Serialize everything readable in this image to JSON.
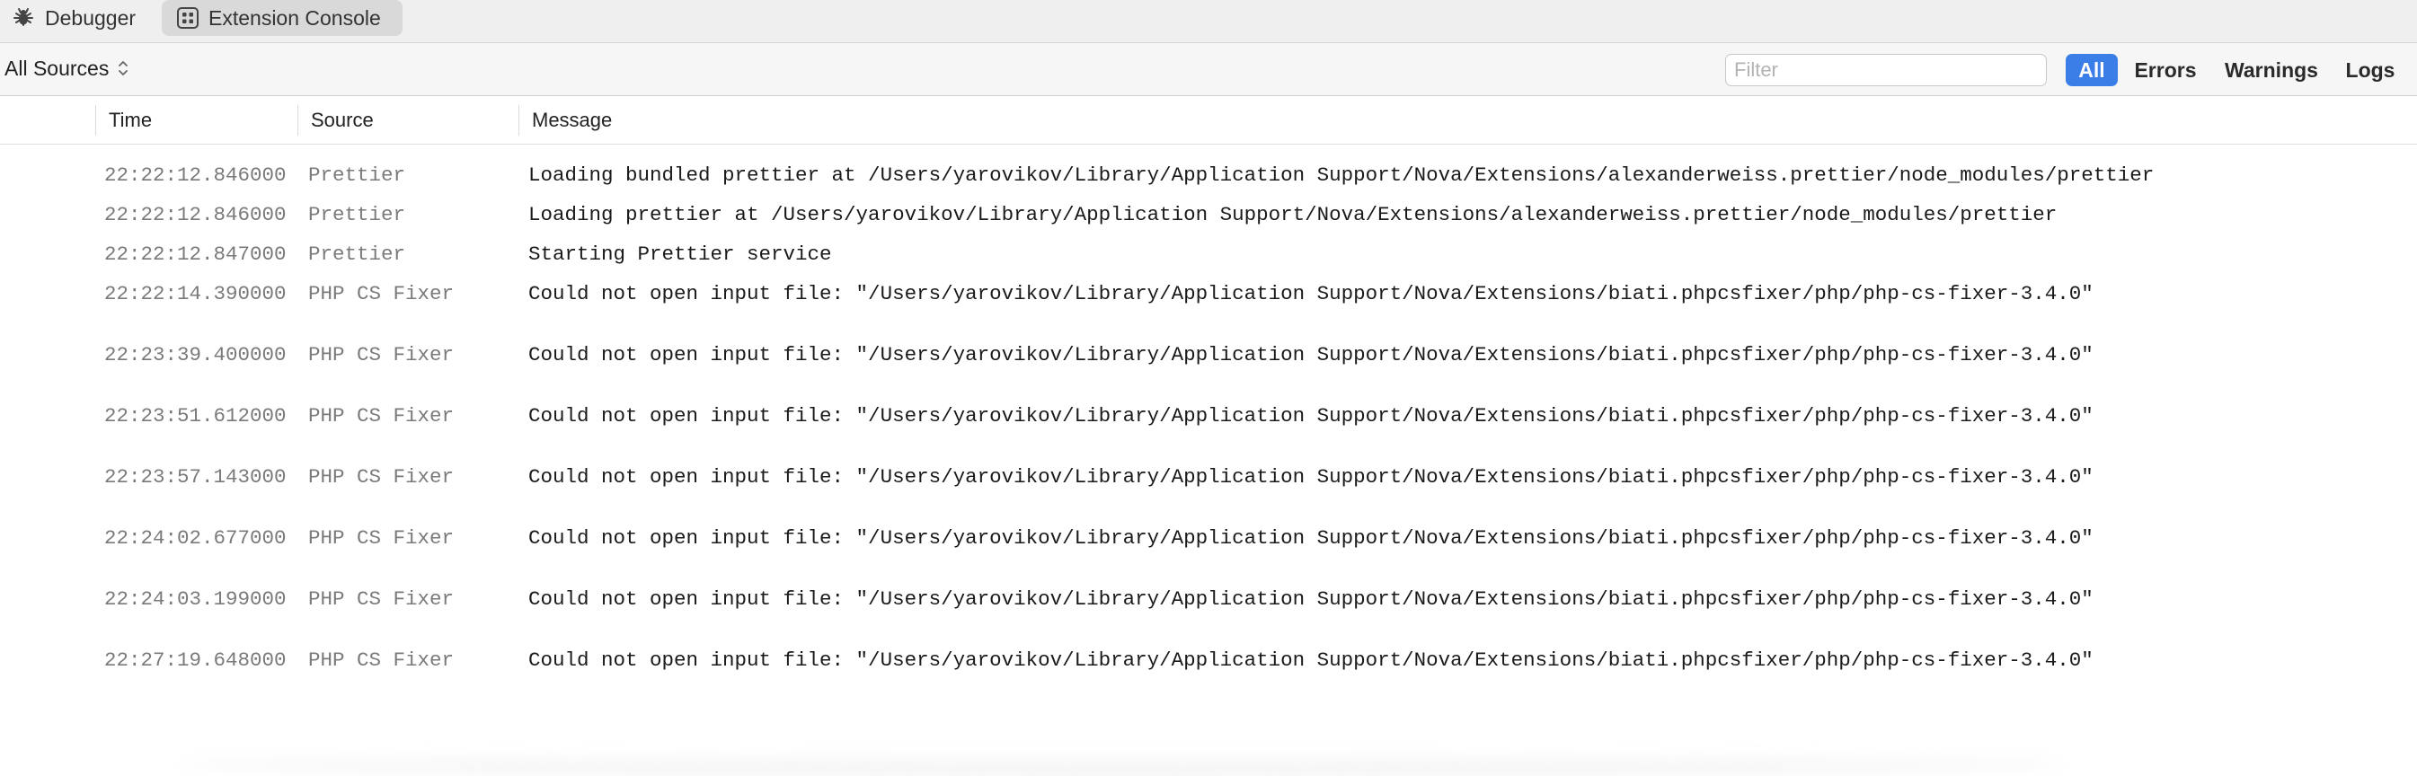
{
  "tabs": [
    {
      "label": "Debugger",
      "icon": "bug-icon",
      "active": false
    },
    {
      "label": "Extension Console",
      "icon": "extension-grid-icon",
      "active": true
    }
  ],
  "toolbar": {
    "sources_selected": "All Sources",
    "filter_placeholder": "Filter",
    "filter_value": "",
    "levels": [
      "All",
      "Errors",
      "Warnings",
      "Logs"
    ],
    "active_level": "All",
    "accent_color": "#3b7ee8"
  },
  "columns": {
    "time": "Time",
    "source": "Source",
    "message": "Message"
  },
  "logs": [
    {
      "time": "22:22:12.846000",
      "source": "Prettier",
      "message": "Loading bundled prettier at /Users/yarovikov/Library/Application Support/Nova/Extensions/alexanderweiss.prettier/node_modules/prettier"
    },
    {
      "time": "22:22:12.846000",
      "source": "Prettier",
      "message": "Loading prettier at /Users/yarovikov/Library/Application Support/Nova/Extensions/alexanderweiss.prettier/node_modules/prettier"
    },
    {
      "time": "22:22:12.847000",
      "source": "Prettier",
      "message": "Starting Prettier service"
    },
    {
      "time": "22:22:14.390000",
      "source": "PHP CS Fixer",
      "message": "Could not open input file: \"/Users/yarovikov/Library/Application Support/Nova/Extensions/biati.phpcsfixer/php/php-cs-fixer-3.4.0\""
    },
    {
      "time": "22:23:39.400000",
      "source": "PHP CS Fixer",
      "message": "Could not open input file: \"/Users/yarovikov/Library/Application Support/Nova/Extensions/biati.phpcsfixer/php/php-cs-fixer-3.4.0\""
    },
    {
      "time": "22:23:51.612000",
      "source": "PHP CS Fixer",
      "message": "Could not open input file: \"/Users/yarovikov/Library/Application Support/Nova/Extensions/biati.phpcsfixer/php/php-cs-fixer-3.4.0\""
    },
    {
      "time": "22:23:57.143000",
      "source": "PHP CS Fixer",
      "message": "Could not open input file: \"/Users/yarovikov/Library/Application Support/Nova/Extensions/biati.phpcsfixer/php/php-cs-fixer-3.4.0\""
    },
    {
      "time": "22:24:02.677000",
      "source": "PHP CS Fixer",
      "message": "Could not open input file: \"/Users/yarovikov/Library/Application Support/Nova/Extensions/biati.phpcsfixer/php/php-cs-fixer-3.4.0\""
    },
    {
      "time": "22:24:03.199000",
      "source": "PHP CS Fixer",
      "message": "Could not open input file: \"/Users/yarovikov/Library/Application Support/Nova/Extensions/biati.phpcsfixer/php/php-cs-fixer-3.4.0\""
    },
    {
      "time": "22:27:19.648000",
      "source": "PHP CS Fixer",
      "message": "Could not open input file: \"/Users/yarovikov/Library/Application Support/Nova/Extensions/biati.phpcsfixer/php/php-cs-fixer-3.4.0\""
    }
  ]
}
